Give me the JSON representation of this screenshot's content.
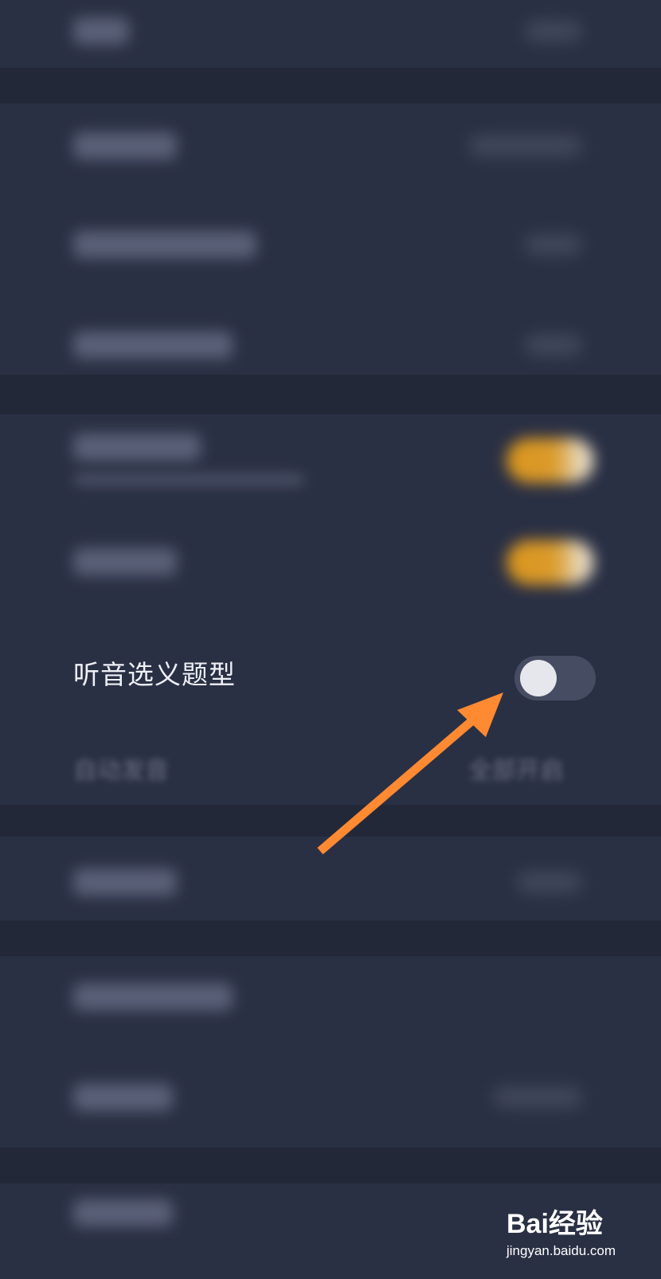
{
  "settings": {
    "listening_question_type": {
      "label": "听音选义题型",
      "enabled": false
    },
    "blurred_row_auto_pronounce_value": "全部开启",
    "blurred_row_auto_pronounce_label": "自动发音"
  },
  "annotation": {
    "arrow_color": "#ff8a32"
  },
  "watermark": {
    "brand": "Bai经验",
    "url": "jingyan.baidu.com"
  },
  "colors": {
    "background": "#2a3044",
    "accent_toggle_on": "#e39b1c"
  }
}
